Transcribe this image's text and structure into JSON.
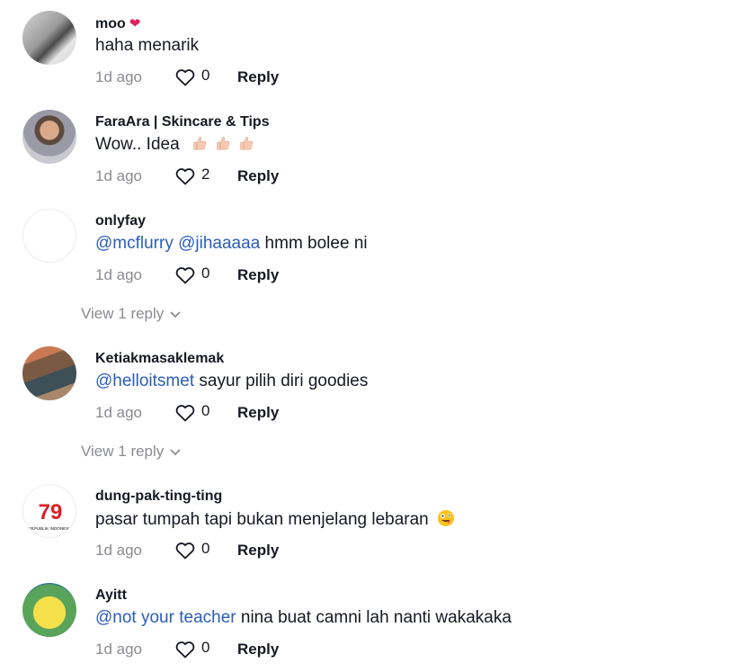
{
  "comments": [
    {
      "username": "moo",
      "username_badge": "❤",
      "text_plain": "haha menarik",
      "time": "1d ago",
      "likes": "0",
      "reply_label": "Reply"
    },
    {
      "username": "FaraAra | Skincare & Tips",
      "text_plain": "Wow.. Idea",
      "time": "1d ago",
      "likes": "2",
      "reply_label": "Reply"
    },
    {
      "username": "onlyfay",
      "mention1": "@mcflurry",
      "mention2": "@jihaaaaa",
      "text_plain": "hmm bolee ni",
      "time": "1d ago",
      "likes": "0",
      "reply_label": "Reply",
      "view_replies": "View 1 reply"
    },
    {
      "username": "Ketiakmasaklemak",
      "mention1": "@helloitsmet",
      "text_plain": "sayur pilih diri goodies",
      "time": "1d ago",
      "likes": "0",
      "reply_label": "Reply",
      "view_replies": "View 1 reply"
    },
    {
      "username": "dung-pak-ting-ting",
      "text_plain": "pasar tumpah tapi bukan menjelang lebaran",
      "avatar_logo_text": "79",
      "avatar_logo_caption": "REPUBLIK INDONESIA",
      "time": "1d ago",
      "likes": "0",
      "reply_label": "Reply"
    },
    {
      "username": "Ayitt",
      "mention1": "@not your teacher",
      "text_plain": "nina buat camni lah nanti wakakaka",
      "time": "1d ago",
      "likes": "0",
      "reply_label": "Reply"
    }
  ],
  "colors": {
    "mention": "#2b5db9",
    "muted": "#8a8b91",
    "text": "#161823",
    "heart_badge": "#e0245e"
  }
}
